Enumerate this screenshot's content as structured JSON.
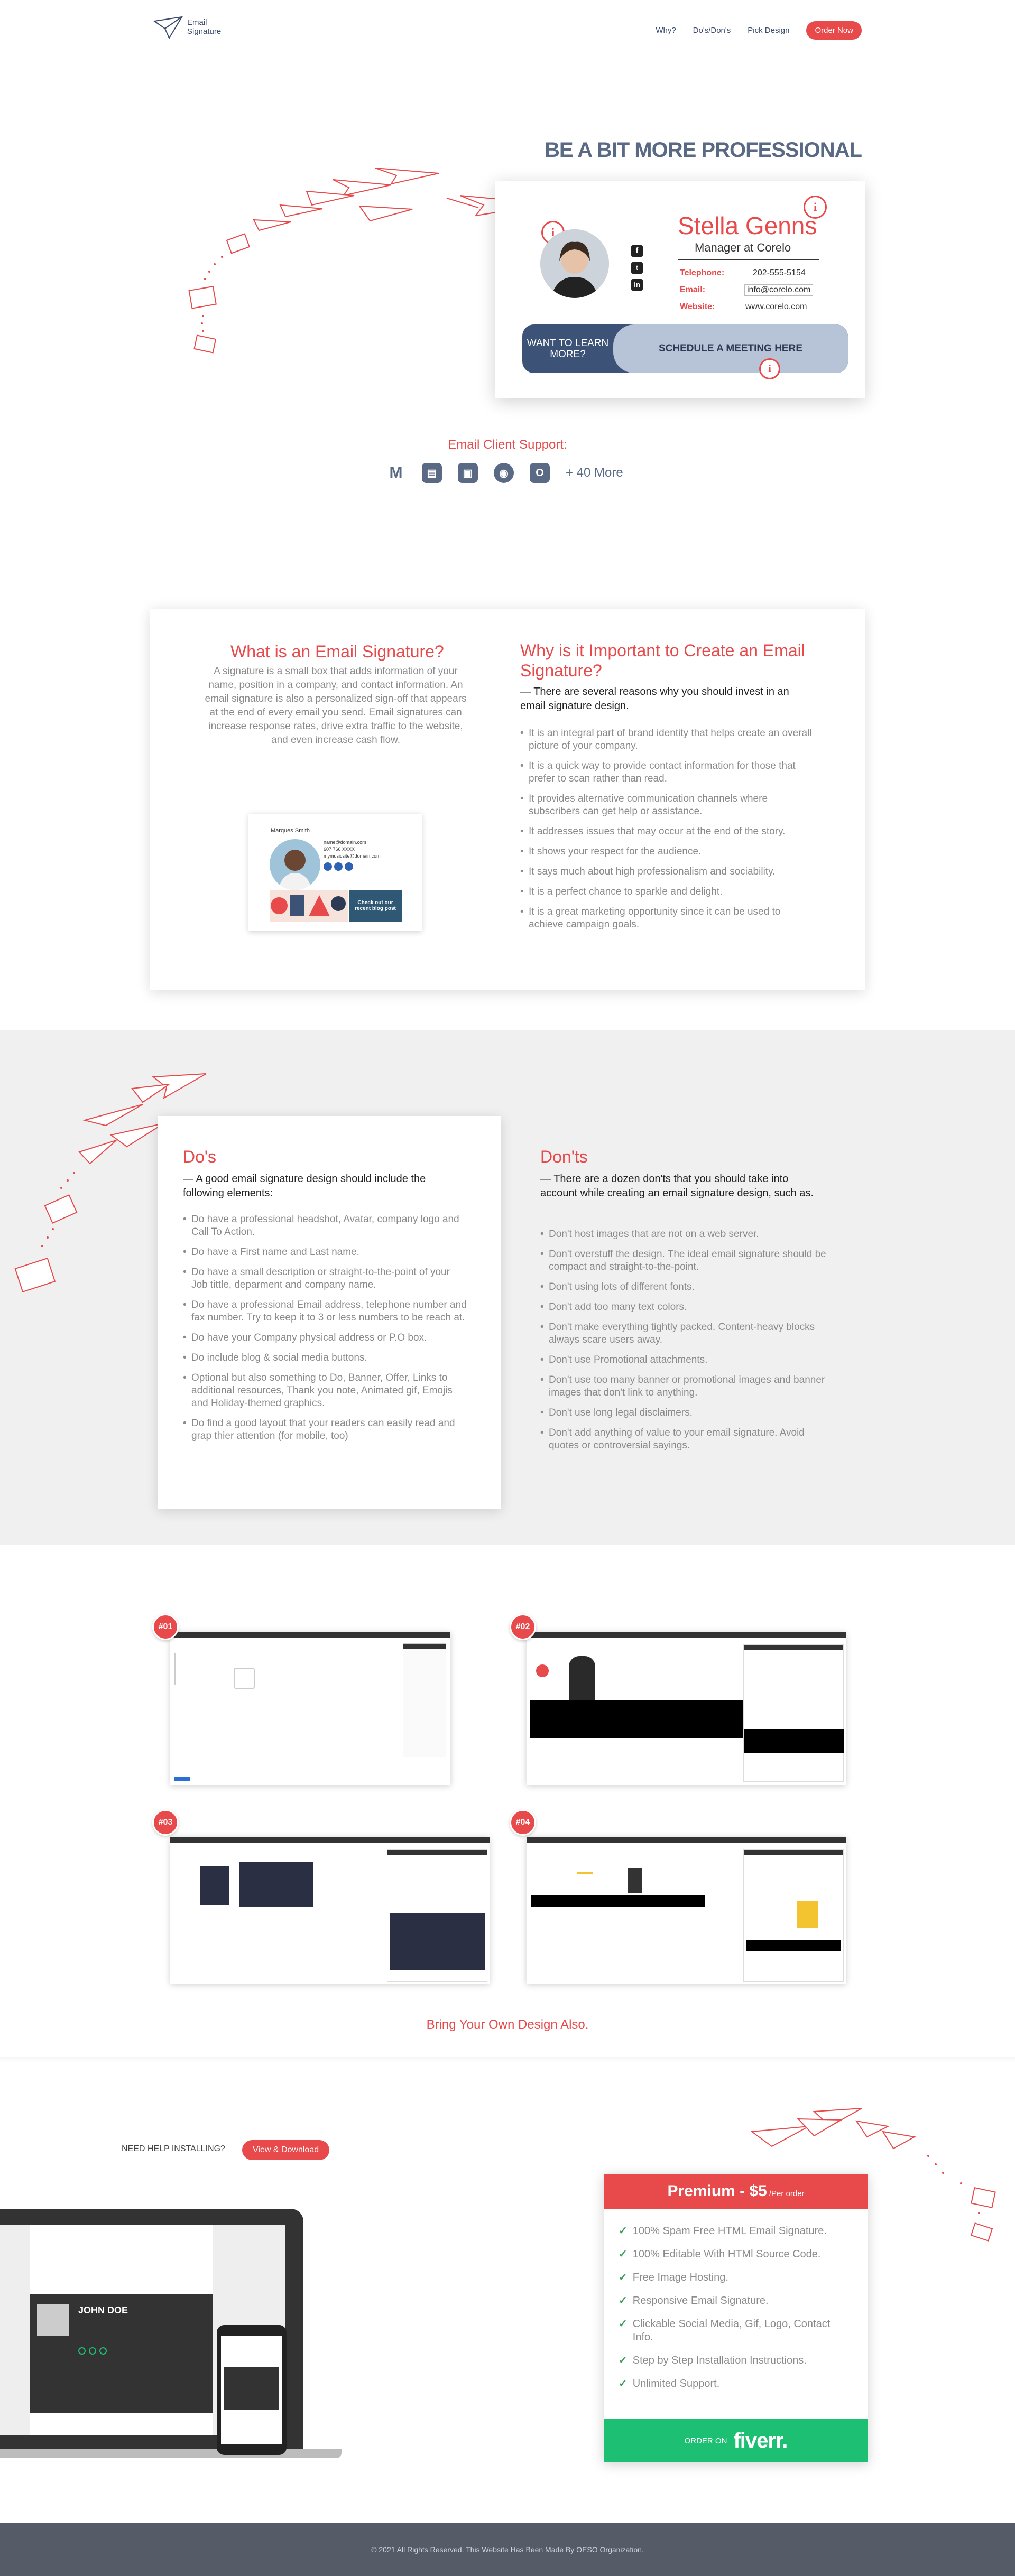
{
  "header": {
    "logo_line1": "Email",
    "logo_line2": "Signature",
    "nav": [
      "Why?",
      "Do's/Don's",
      "Pick Design"
    ],
    "cta": "Order Now"
  },
  "hero": {
    "title": "BE A BIT MORE PROFESSIONAL",
    "signature": {
      "name": "Stella Genns",
      "role": "Manager at Corelo",
      "telephone_label": "Telephone:",
      "telephone": "202-555-5154",
      "email_label": "Email:",
      "email": "info@corelo.com",
      "website_label": "Website:",
      "website": "www.corelo.com",
      "social": [
        "facebook-icon",
        "twitter-icon",
        "linkedin-icon"
      ]
    },
    "want_more": "WANT TO LEARN MORE?",
    "schedule": "SCHEDULE A MEETING HERE",
    "info_glyph": "i"
  },
  "support": {
    "title": "Email Client Support:",
    "clients": [
      "gmail-icon",
      "outlook-icon",
      "apple-mail-icon",
      "thunderbird-icon",
      "office365-icon"
    ],
    "client_glyphs": [
      "M",
      "▤",
      "▣",
      "◉",
      "O"
    ],
    "more": "+ 40 More"
  },
  "what": {
    "title": "What is an Email Signature?",
    "body": "A signature is a small box that adds information of your name, position in a company, and contact information. An email signature is also a personalized sign-off that appears at the end of every email you send. Email signatures can increase response rates, drive extra traffic to the website, and even increase cash flow.",
    "mini": {
      "name": "Marques Smith",
      "lines": [
        "name@domain.com",
        "607 766 XXXX",
        "mymusicsite@domain.com"
      ],
      "cta": "Check out our recent blog post"
    }
  },
  "why": {
    "title": "Why is it Important to Create an Email Signature?",
    "intro": "— There are several reasons why you should invest in an email signature design.",
    "items": [
      "It is an integral part of brand identity that helps create an overall picture of your company.",
      "It is a quick way to provide contact information for those that prefer to scan rather than read.",
      "It provides alternative communication channels where subscribers can get help or assistance.",
      "It addresses issues that may occur at the end of the story.",
      "It shows your respect for the audience.",
      "It says much about high professionalism and sociability.",
      "It is a perfect chance to sparkle and delight.",
      "It is a great marketing opportunity since it can be used to achieve campaign goals."
    ]
  },
  "dos": {
    "title": "Do's",
    "intro": "— A good email signature design should include the following elements:",
    "items": [
      "Do have a professional headshot, Avatar, company logo and Call To Action.",
      "Do have a First name and Last name.",
      "Do have a small description or straight-to-the-point of your Job tittle, deparment and company name.",
      "Do have a professional Email address, telephone number and fax number. Try to keep it to 3 or less numbers to be reach at.",
      "Do have your Company physical address or P.O box.",
      "Do include blog & social media buttons.",
      "Optional but also something to Do, Banner, Offer, Links to additional resources, Thank you note, Animated gif, Emojis and Holiday-themed graphics.",
      "Do find a good layout that your readers can easily read and grap thier attention (for mobile, too)"
    ]
  },
  "donts": {
    "title": "Don'ts",
    "intro": "— There are a dozen don'ts that you should take into account while creating an email signature design, such as.",
    "items": [
      "Don't host images that are not on a web server.",
      "Don't overstuff the design. The ideal email signature should be compact and straight-to-the-point.",
      "Don't using lots of different fonts.",
      "Don't add too many text colors.",
      "Don't make everything tightly packed. Content-heavy blocks always scare users away.",
      "Don't use Promotional attachments.",
      "Don't use too many banner or promotional images and banner images that don't link to anything.",
      "Don't use long legal disclaimers.",
      "Don't add anything of value to your email signature. Avoid quotes or controversial sayings."
    ]
  },
  "gallery": {
    "items": [
      {
        "num": "#01",
        "style": "white"
      },
      {
        "num": "#02",
        "style": "black"
      },
      {
        "num": "#03",
        "style": "navy"
      },
      {
        "num": "#04",
        "style": "yellow"
      }
    ],
    "byod": "Bring Your Own Design Also."
  },
  "install": {
    "need": "NEED HELP INSTALLING?",
    "button": "View & Download",
    "laptop_name": "JOHN DOE"
  },
  "pricing": {
    "title": "Premium - $5",
    "per": "/Per order",
    "features": [
      "100% Spam Free HTML Email Signature.",
      "100% Editable With HTMl Source Code.",
      "Free Image Hosting.",
      "Responsive Email Signature.",
      "Clickable Social Media, Gif, Logo, Contact Info.",
      "Step by Step Installation Instructions.",
      "Unlimited Support."
    ],
    "order_on": "ORDER ON",
    "brand": "fiverr."
  },
  "footer": {
    "text": "© 2021 All Rights Reserved. This Website Has Been Made By OESO Organization."
  },
  "colors": {
    "accent": "#e8494b",
    "navy": "#3d5277",
    "green": "#1dbf73"
  }
}
